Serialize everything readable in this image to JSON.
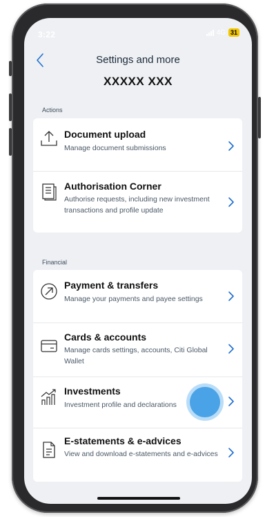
{
  "status_bar": {
    "time": "3:22",
    "network": "4G",
    "battery": "31"
  },
  "header": {
    "title": "Settings and more",
    "user_name": "XXXXX XXX"
  },
  "sections": {
    "actions": {
      "label": "Actions",
      "items": [
        {
          "title": "Document upload",
          "description": "Manage document submissions",
          "icon": "upload-icon"
        },
        {
          "title": "Authorisation Corner",
          "description": "Authorise requests, including new investment transactions and profile update",
          "icon": "document-list-icon"
        }
      ]
    },
    "financial": {
      "label": "Financial",
      "items": [
        {
          "title": "Payment & transfers",
          "description": "Manage your payments and payee settings",
          "icon": "transfer-arrow-icon"
        },
        {
          "title": "Cards & accounts",
          "description": "Manage cards settings, accounts, Citi Global Wallet",
          "icon": "card-icon"
        },
        {
          "title": "Investments",
          "description": "Investment profile and declarations",
          "icon": "investment-chart-icon"
        },
        {
          "title": "E-statements & e-advices",
          "description": "View and download e-statements and e-advices",
          "icon": "e-statement-icon"
        }
      ]
    }
  },
  "colors": {
    "background": "#eef0f3",
    "card": "#ffffff",
    "accent": "#1f6fd1",
    "touch_indicator": "#4aa3e6"
  }
}
